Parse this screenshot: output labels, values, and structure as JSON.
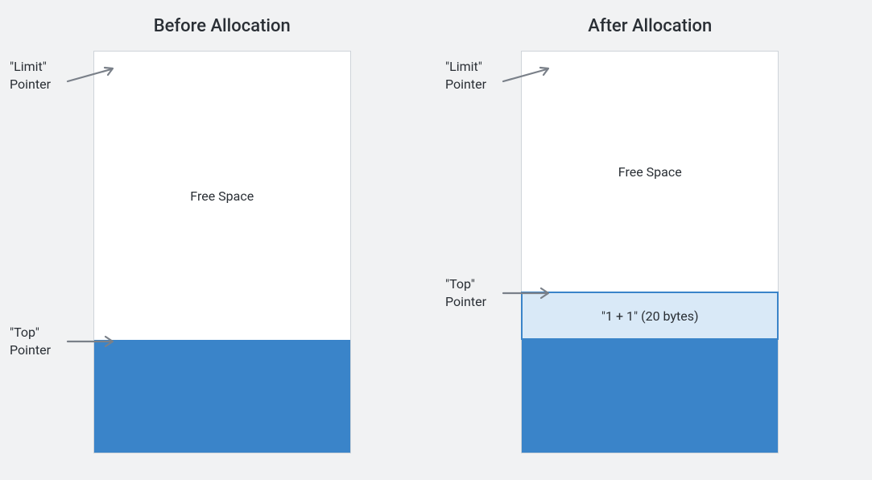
{
  "before": {
    "title": "Before Allocation",
    "limit_label_line1": "\"Limit\"",
    "limit_label_line2": "Pointer",
    "top_label_line1": "\"Top\"",
    "top_label_line2": "Pointer",
    "free_space_label": "Free Space"
  },
  "after": {
    "title": "After Allocation",
    "limit_label_line1": "\"Limit\"",
    "limit_label_line2": "Pointer",
    "top_label_line1": "\"Top\"",
    "top_label_line2": "Pointer",
    "free_space_label": "Free Space",
    "alloc_label": "\"1 + 1\" (20 bytes)"
  },
  "colors": {
    "used_fill": "#3a84c9",
    "alloc_fill": "#d9e9f7",
    "alloc_border": "#3a84c9",
    "arrow": "#7a8089",
    "text": "#2a2f35",
    "bg": "#f1f2f3"
  }
}
